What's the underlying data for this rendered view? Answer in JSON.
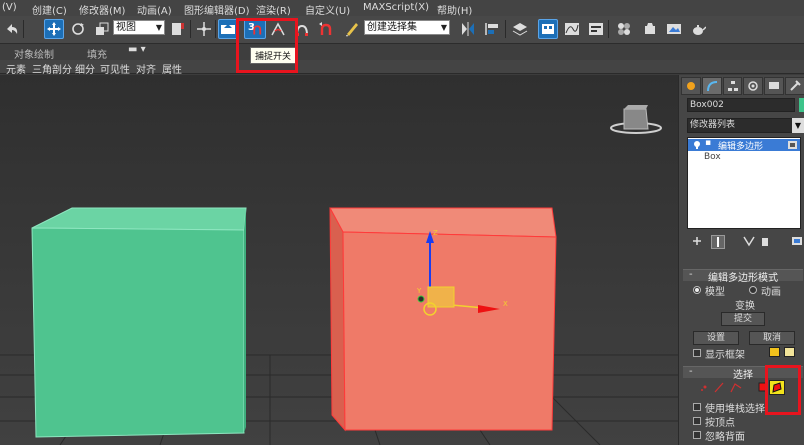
{
  "menu": {
    "items": [
      "(V)",
      "创建(C)",
      "修改器(M)",
      "动画(A)",
      "图形编辑器(D)",
      "渲染(R)",
      "自定义(U)",
      "MAXScript(X)",
      "帮助(H)"
    ]
  },
  "toolbar": {
    "view_dropdown": "视图",
    "selection_set_dropdown": "创建选择集",
    "snap_label": "3",
    "tooltip": "捕捉开关"
  },
  "ribbon": {
    "row1": [
      "对象绘制",
      "填充"
    ],
    "row2": [
      "元素",
      "三角剖分",
      "细分",
      "可见性",
      "对齐",
      "属性"
    ]
  },
  "command_panel": {
    "object_name": "Box002",
    "object_color": "#3dc48a",
    "modifier_list": "修改器列表",
    "stack": {
      "active_modifier": "编辑多边形",
      "base_object": "Box"
    },
    "edit_poly_mode": {
      "title": "编辑多边形模式",
      "mode_model": "模型",
      "mode_animate": "动画",
      "transform_label": "变换",
      "commit_button": "提交",
      "settings_button": "设置",
      "cancel_button": "取消",
      "show_cage": "显示框架"
    },
    "selection": {
      "title": "选择",
      "by_vertex": "使用堆栈选择",
      "by_vertex2": "按顶点",
      "ignore_backfacing": "忽略背面"
    }
  },
  "colors": {
    "green_box": "#4fc48f",
    "red_box": "#ef7a68",
    "highlight": "#e8141e",
    "accent": "#1c6fb7"
  }
}
